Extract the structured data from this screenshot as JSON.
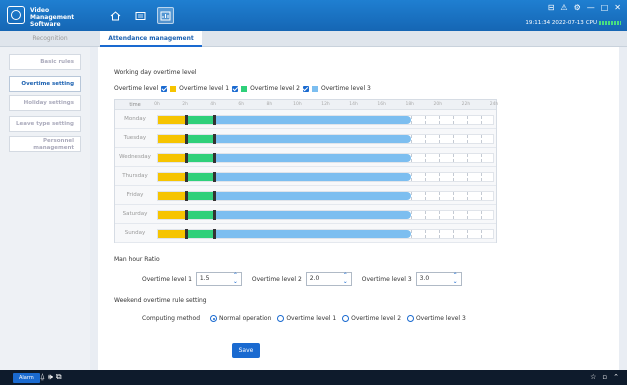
{
  "app": {
    "title_line1": "Video Management",
    "title_line2": "Software",
    "datetime": "19:11:34 2022-07-13",
    "cpu_label": "CPU"
  },
  "window_controls": [
    "⊟",
    "⚠",
    "⚙",
    "—",
    "□",
    "✕"
  ],
  "tabs": [
    "Recognition",
    "Attendance management"
  ],
  "sidebar": [
    {
      "label": "Basic rules"
    },
    {
      "label": "Overtime setting"
    },
    {
      "label": "Holiday settings"
    },
    {
      "label": "Leave type setting"
    },
    {
      "label_line1": "Personnel",
      "label_line2": "management"
    }
  ],
  "section_overtime": "Working day overtime level",
  "legend": {
    "prefix": "Overtime level",
    "items": [
      {
        "label": "Overtime level 1",
        "color": "#f6c400"
      },
      {
        "label": "Overtime level 2",
        "color": "#2fd07a"
      },
      {
        "label": "Overtime level 3",
        "color": "#7cbef0"
      }
    ]
  },
  "timeline": {
    "header_label": "time",
    "ticks": [
      "0h",
      "2h",
      "4h",
      "6h",
      "8h",
      "10h",
      "12h",
      "14h",
      "16h",
      "18h",
      "20h",
      "22h",
      "24h"
    ],
    "days": [
      "Monday",
      "Tuesday",
      "Wednesday",
      "Thursday",
      "Friday",
      "Saturday",
      "Sunday"
    ],
    "level1_hours": [
      0,
      2
    ],
    "level2_hours": [
      2,
      4
    ],
    "level3_hours": [
      4,
      18
    ]
  },
  "section_ratio": "Man hour Ratio",
  "ratio": [
    {
      "label": "Overtime level 1",
      "value": "1.5"
    },
    {
      "label": "Overtime level 2",
      "value": "2.0"
    },
    {
      "label": "Overtime level 3",
      "value": "3.0"
    }
  ],
  "section_weekend": "Weekend overtime rule setting",
  "weekend": {
    "label": "Computing method",
    "options": [
      "Normal operation",
      "Overtime level 1",
      "Overtime level 2",
      "Overtime level 3"
    ],
    "selected": "Normal operation"
  },
  "save_label": "Save",
  "bottom": {
    "alarm_label": "Alarm"
  }
}
